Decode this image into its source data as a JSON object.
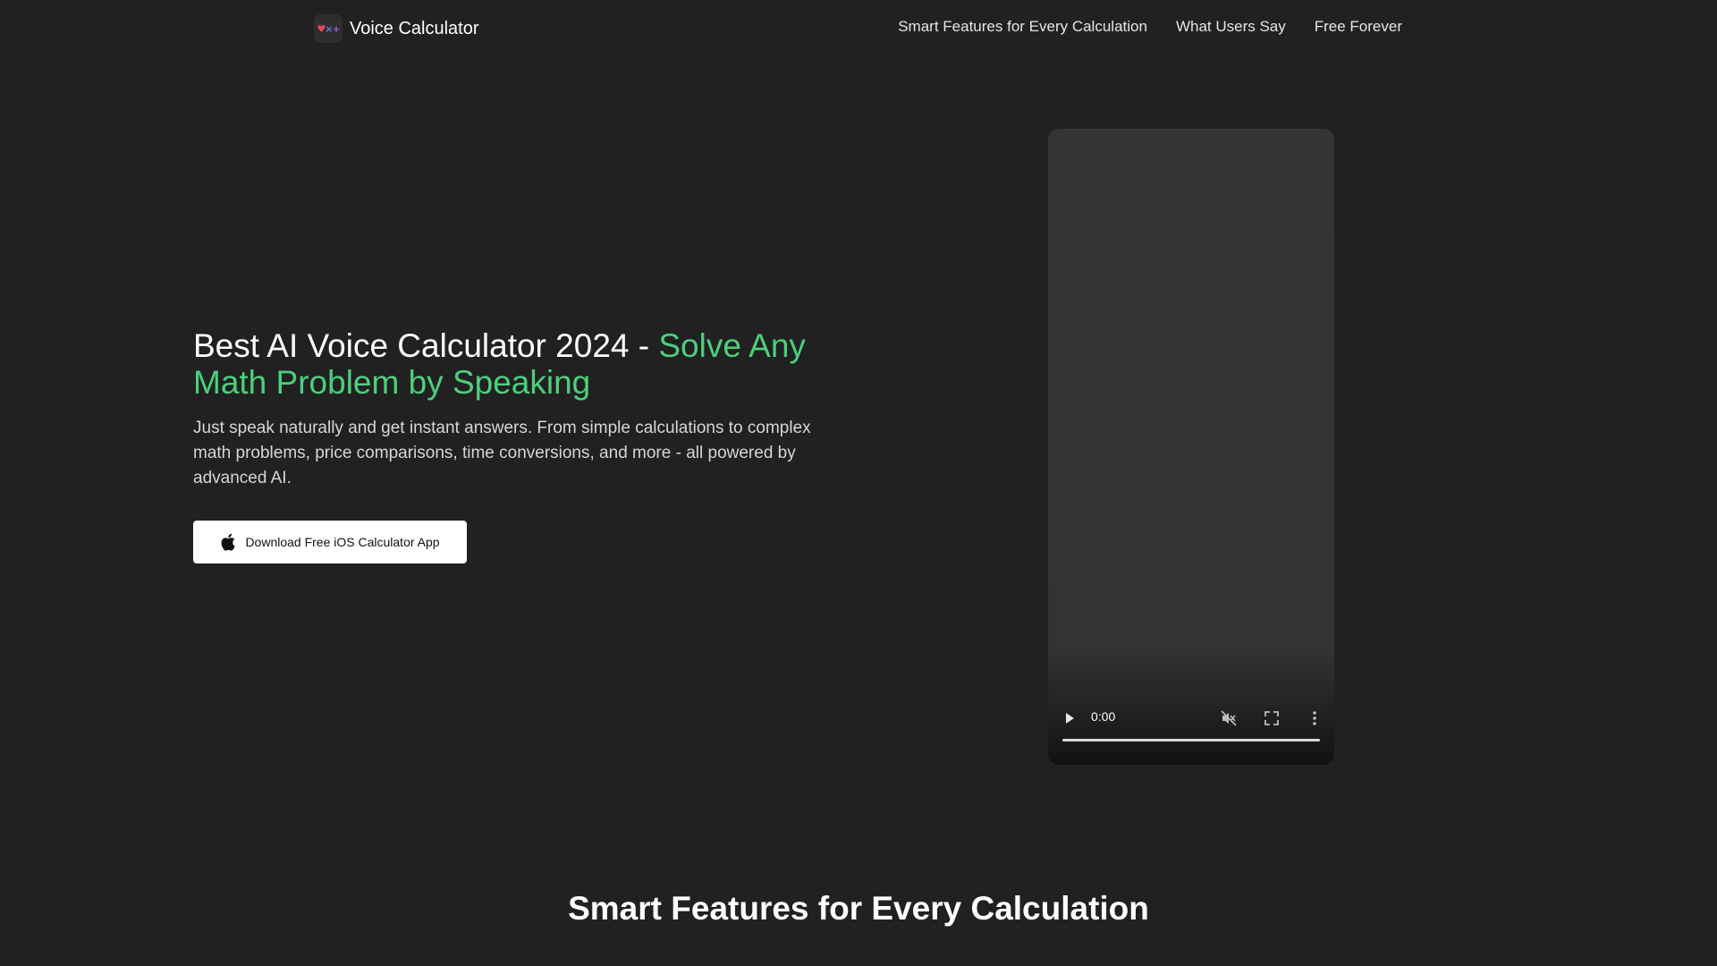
{
  "header": {
    "brand_name": "Voice Calculator",
    "logo_glyphs": {
      "heart": "♥",
      "times": "×",
      "plus": "+"
    },
    "nav": [
      "Smart Features for Every Calculation",
      "What Users Say",
      "Free Forever"
    ]
  },
  "hero": {
    "title_plain": "Best AI Voice Calculator 2024 - ",
    "title_accent": "Solve Any Math Problem by Speaking",
    "description": "Just speak naturally and get instant answers. From simple calculations to complex math problems, price comparisons, time conversions, and more - all powered by advanced AI.",
    "cta_label": "Download Free iOS Calculator App",
    "cta_icon": "apple-icon"
  },
  "video": {
    "time": "0:00",
    "progress": 0,
    "muted": true
  },
  "sections": {
    "features_title": "Smart Features for Every Calculation"
  },
  "colors": {
    "background": "#212121",
    "accent": "#4ccf7d",
    "video_bg": "#333333"
  }
}
